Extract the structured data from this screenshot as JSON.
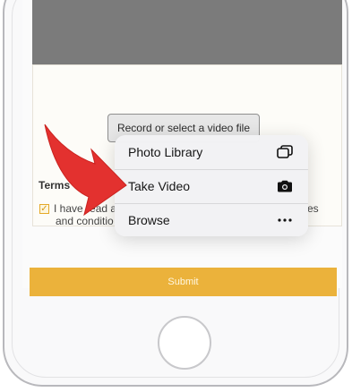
{
  "form": {
    "record_button_label": "Record or select a video file",
    "terms_heading": "Terms",
    "terms_line1": "I have read a",
    "terms_line2": "and conditio",
    "terms_tail": "es",
    "terms_checked": true,
    "submit_label": "Submit"
  },
  "menu": {
    "items": [
      {
        "label": "Photo Library",
        "icon": "photo-library-icon"
      },
      {
        "label": "Take Video",
        "icon": "camera-icon"
      },
      {
        "label": "Browse",
        "icon": "more-icon"
      }
    ]
  },
  "colors": {
    "accent": "#ebb23b",
    "arrow": "#e3312f",
    "video_placeholder": "#7b7b7b"
  }
}
